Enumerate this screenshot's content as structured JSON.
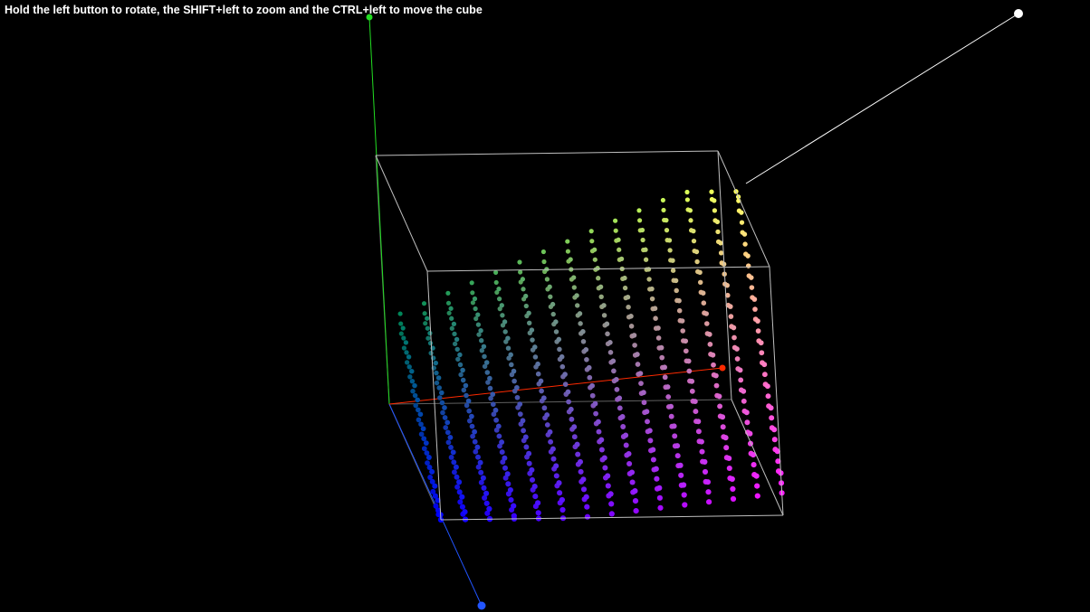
{
  "viewer": {
    "help_text": "Hold the left button to rotate, the SHIFT+left to zoom and the CTRL+left to move the cube"
  },
  "colors": {
    "background": "#000000",
    "cube_edges": "#bfbfbf",
    "x_axis": "#ff2a00",
    "y_axis": "#22dd22",
    "z_axis": "#2255ff",
    "light_axis": "#ffffff",
    "help_text": "#ffffff"
  },
  "icons": {
    "x_axis_handle": "red-dot-icon",
    "y_axis_handle": "green-dot-icon",
    "z_axis_handle": "blue-dot-icon",
    "light_handle": "white-dot-icon"
  }
}
